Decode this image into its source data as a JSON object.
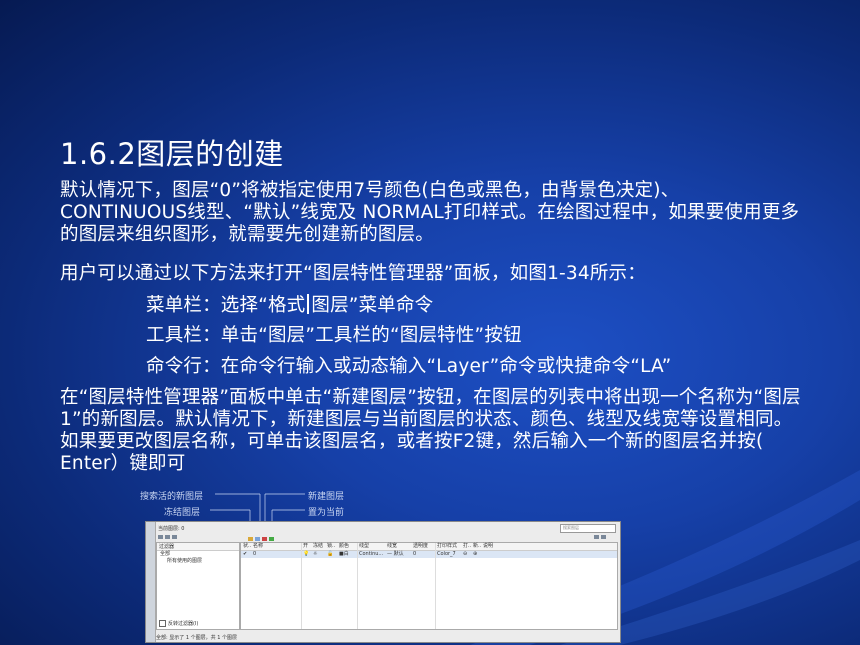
{
  "title": "1.6.2图层的创建",
  "paragraphs": {
    "p1": "默认情况下，图层“0”将被指定使用7号颜色(白色或黑色，由背景色决定)、CONTINUOUS线型、“默认”线宽及 NORMAL打印样式。在绘图过程中，如果要使用更多的图层来组织图形，就需要先创建新的图层。",
    "p2": "用户可以通过以下方法来打开“图层特性管理器”面板，如图1-34所示：",
    "menu_a": "菜单栏：选择“格式",
    "menu_b": "图层”菜单命令",
    "toolbar": "工具栏：单击“图层”工具栏的“图层特性”按钮",
    "cmdline": "命令行：在命令行输入或动态输入“Layer”命令或快捷命令“LA”",
    "p3": "在“图层特性管理器”面板中单击“新建图层”按钮，在图层的列表中将出现一个名称为“图层1”的新图层。默认情况下，新建图层与当前图层的状态、颜色、线型及线宽等设置相同。如果要更改图层名称，可单击该图层名，或者按F2键，然后输入一个新的图层名并按( Enter）键即可"
  },
  "callouts": {
    "left1": "搜索活的新图层",
    "left2": "冻结图层",
    "right1": "新建图层",
    "right2": "置为当前"
  },
  "dialog": {
    "current_layer": "当前图层: 0",
    "search_placeholder": "搜索图层",
    "filter_header": "过滤器",
    "tree_all": "全部",
    "tree_used": "所有使用的图层",
    "invert_filter": "反转过滤器(I)",
    "status": "全部: 显示了 1 个图层，共 1 个图层",
    "columns": [
      "状..",
      "名称",
      "开",
      "冻结",
      "锁..",
      "颜色",
      "线型",
      "线宽",
      "透明度",
      "打印样式",
      "打..",
      "新..",
      "说明"
    ],
    "row": [
      "✔",
      "0",
      "💡",
      "☼",
      "🔓",
      "■白",
      "Continu...",
      "— 默认",
      "0",
      "Color_7",
      "⊖",
      "⊕",
      ""
    ]
  },
  "colors": {
    "background": "#1640a8",
    "text": "#ffffff"
  }
}
